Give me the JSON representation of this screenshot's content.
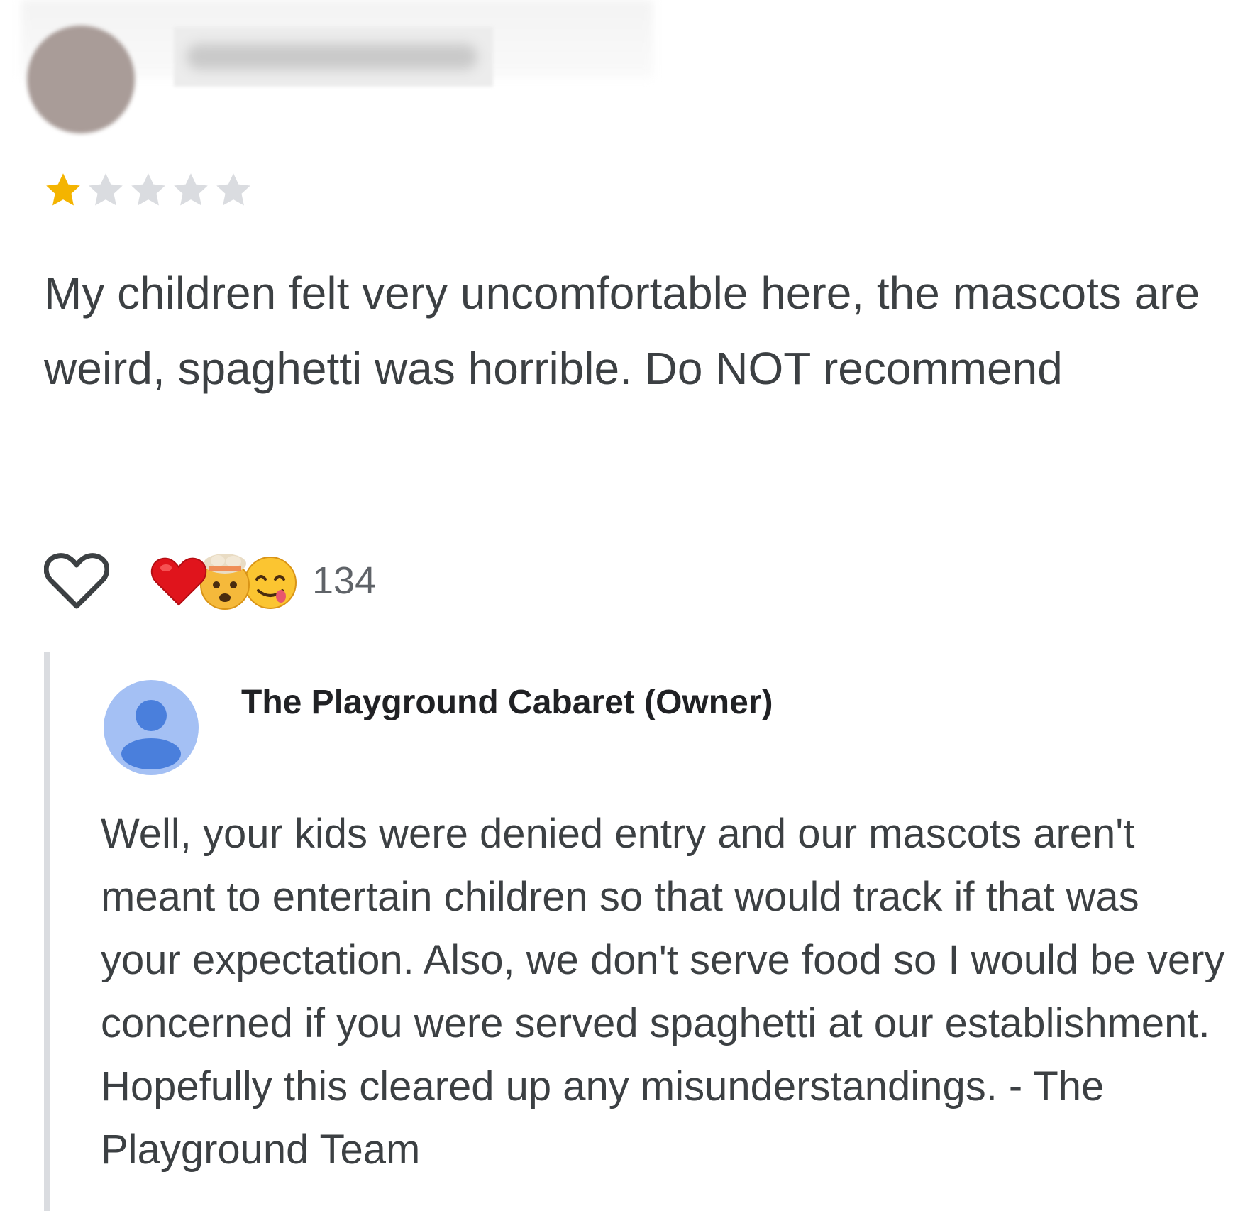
{
  "review": {
    "rating": 1,
    "rating_max": 5,
    "star_color_filled": "#f4b400",
    "star_color_empty": "#dadce0",
    "text": "My children felt very uncomfortable here, the mascots are weird, spaghetti was horrible. Do NOT recommend"
  },
  "reactions": {
    "like_icon": "heart-outline-icon",
    "emojis": [
      "red-heart-emoji",
      "exploding-head-emoji",
      "yum-face-emoji"
    ],
    "count": "134"
  },
  "owner_reply": {
    "name": "The Playground Cabaret (Owner)",
    "avatar_icon": "default-person-icon",
    "avatar_color": "#a4c0f4",
    "avatar_figure_color": "#4a7fdc",
    "text": "Well, your kids were denied entry and our mascots aren't meant to entertain children so that would track if that was your expectation. Also, we don't serve food so I would be very concerned if you were served spaghetti at our establishment. Hopefully this cleared up any misunderstandings. - The Playground Team"
  }
}
